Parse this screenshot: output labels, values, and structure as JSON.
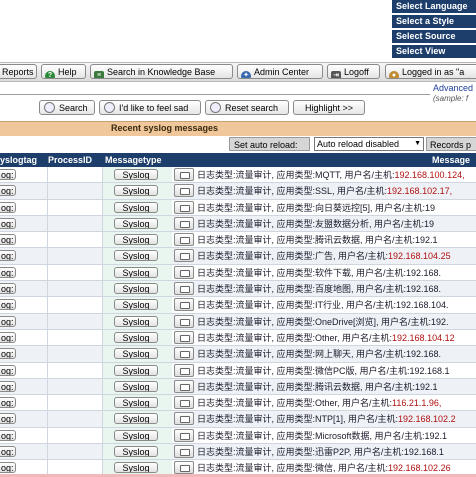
{
  "menu": [
    "Select Language",
    "Select a Style",
    "Select Source",
    "Select View"
  ],
  "toolbar": {
    "reports": "Reports",
    "help": "Help",
    "kb": "Search in Knowledge Base",
    "admin": "Admin Center",
    "logoff": "Logoff",
    "loggedin": "Logged in as \"a"
  },
  "search": {
    "advanced": "Advanced",
    "sample": "(sample: f",
    "search_btn": "Search",
    "feel_sad_btn": "I'd like to feel sad",
    "reset_btn": "Reset search",
    "highlight_btn": "Highlight >>"
  },
  "panel": {
    "title": "Recent syslog messages",
    "auto_reload_label": "Set auto reload:",
    "auto_reload_value": "Auto reload disabled",
    "records_label": "Records p"
  },
  "table": {
    "headers": {
      "syslogtag": "yslogtag",
      "processid": "ProcessID",
      "messagetype": "Messagetype",
      "message": "Message"
    },
    "tag_button": "og:",
    "type_button": "Syslog",
    "rows": [
      {
        "text": "日志类型:流量审计, 应用类型:MQTT, 用户名/主机:",
        "ip": "192.168.100.124,"
      },
      {
        "text": "日志类型:流量审计, 应用类型:SSL, 用户名/主机:",
        "ip": "192.168.102.17,"
      },
      {
        "text": "日志类型:流量审计, 应用类型:向日葵远控[5], 用户名/主机:19",
        "ip": ""
      },
      {
        "text": "日志类型:流量审计, 应用类型:友盟数据分析, 用户名/主机:19",
        "ip": ""
      },
      {
        "text": "日志类型:流量审计, 应用类型:腾讯云数据, 用户名/主机:192.1",
        "ip": ""
      },
      {
        "text": "日志类型:流量审计, 应用类型:广告, 用户名/主机:",
        "ip": "192.168.104.25"
      },
      {
        "text": "日志类型:流量审计, 应用类型:软件下载, 用户名/主机:192.168.",
        "ip": ""
      },
      {
        "text": "日志类型:流量审计, 应用类型:百度地图, 用户名/主机:192.168.",
        "ip": ""
      },
      {
        "text": "日志类型:流量审计, 应用类型:IT行业, 用户名/主机:192.168.104.",
        "ip": ""
      },
      {
        "text": "日志类型:流量审计, 应用类型:OneDrive[浏览], 用户名/主机:192.",
        "ip": ""
      },
      {
        "text": "日志类型:流量审计, 应用类型:Other, 用户名/主机:",
        "ip": "192.168.104.12"
      },
      {
        "text": "日志类型:流量审计, 应用类型:网上聊天, 用户名/主机:192.168.",
        "ip": ""
      },
      {
        "text": "日志类型:流量审计, 应用类型:微信PC版, 用户名/主机:192.168.1",
        "ip": ""
      },
      {
        "text": "日志类型:流量审计, 应用类型:腾讯云数据, 用户名/主机:192.1",
        "ip": ""
      },
      {
        "text": "日志类型:流量审计, 应用类型:Other, 用户名/主机:",
        "ip": "116.21.1.96,"
      },
      {
        "text": "日志类型:流量审计, 应用类型:NTP[1], 用户名/主机:",
        "ip": "192.168.102.2"
      },
      {
        "text": "日志类型:流量审计, 应用类型:Microsoft数据, 用户名/主机:192.1",
        "ip": ""
      },
      {
        "text": "日志类型:流量审计, 应用类型:迅雷P2P, 用户名/主机:192.168.1",
        "ip": ""
      },
      {
        "text": "日志类型:流量审计, 应用类型:微信, 用户名/主机:",
        "ip": "192.168.102.26"
      }
    ]
  },
  "colors": {
    "nav_dark": "#1d3e6b",
    "title_bar": "#efc79a",
    "ip_red": "#b01010"
  }
}
